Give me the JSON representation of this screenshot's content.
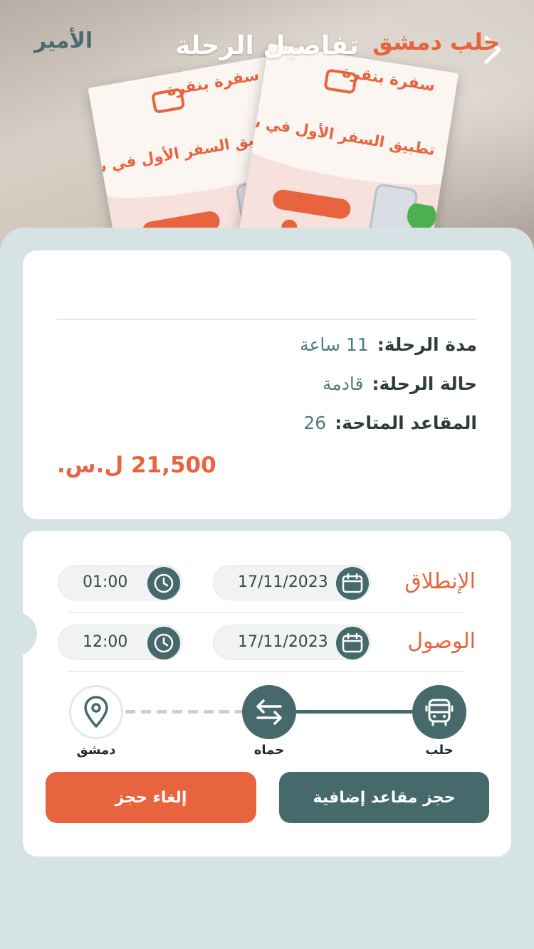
{
  "header": {
    "title": "تفاصيل الرحلة",
    "poster_brand": "سفرة بنقرة",
    "poster_headline": "تطبيق السفر الأول في سوريا"
  },
  "trip": {
    "route": "حلب دمشق",
    "company": "الأمير",
    "duration_label": "مدة الرحلة:",
    "duration_value": "11 ساعة",
    "status_label": "حالة الرحلة:",
    "status_value": "قادمة",
    "seats_label": "المقاعد المتاحة:",
    "seats_value": "26",
    "price": "21,500 ل.س."
  },
  "schedule": {
    "departure_label": "الإنطلاق",
    "departure_date": "17/11/2023",
    "departure_time": "01:00",
    "arrival_label": "الوصول",
    "arrival_date": "17/11/2023",
    "arrival_time": "12:00"
  },
  "stops": [
    {
      "name": "حلب",
      "icon": "bus-icon"
    },
    {
      "name": "حماه",
      "icon": "swap-arrows-icon"
    },
    {
      "name": "دمشق",
      "icon": "location-pin-icon"
    }
  ],
  "actions": {
    "book_more": "حجز مقاعد إضافية",
    "cancel": "إلغاء حجز"
  },
  "colors": {
    "accent": "#e8643f",
    "primary": "#46696c",
    "background": "#d5e3e4"
  }
}
